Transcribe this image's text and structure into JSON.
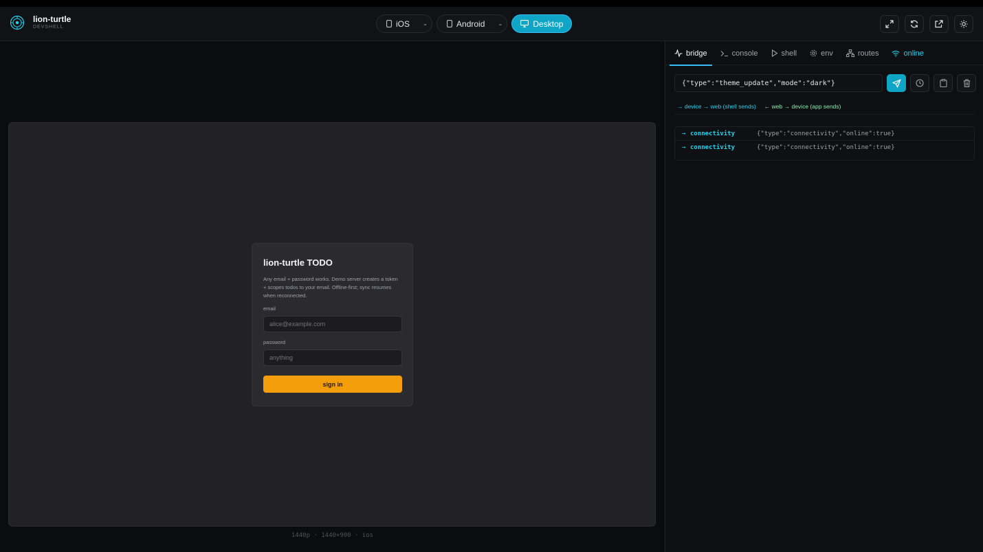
{
  "brand": {
    "title": "lion-turtle",
    "subtitle": "DEVSHELL"
  },
  "devices": [
    {
      "label": "iOS",
      "icon": "phone-icon"
    },
    {
      "label": "Android",
      "icon": "phone-icon"
    },
    {
      "label": "Desktop",
      "icon": "monitor-icon",
      "active": true
    }
  ],
  "header_actions": [
    "expand-icon",
    "refresh-icon",
    "external-link-icon",
    "sun-icon"
  ],
  "preview": {
    "caption": "1440p · 1440×900 · ios",
    "card": {
      "title": "lion-turtle TODO",
      "description": "Any email + password works. Demo server creates a token + scopes todos to your email. Offline-first; sync resumes when reconnected.",
      "email_label": "email",
      "email_placeholder": "alice@example.com",
      "password_label": "password",
      "password_placeholder": "anything",
      "submit_label": "sign in"
    }
  },
  "panel": {
    "tabs": [
      {
        "label": "bridge",
        "icon": "activity-icon"
      },
      {
        "label": "console",
        "icon": "terminal-icon"
      },
      {
        "label": "shell",
        "icon": "play-icon"
      },
      {
        "label": "env",
        "icon": "gear-icon"
      },
      {
        "label": "routes",
        "icon": "network-icon"
      },
      {
        "label": "online",
        "icon": "wifi-icon"
      }
    ],
    "message_value": "{\"type\":\"theme_update\",\"mode\":\"dark\"}",
    "legend": {
      "outgoing": "→ device → web (shell sends)",
      "incoming": "← web → device (app sends)"
    },
    "log": [
      {
        "dir": "→",
        "type": "connectivity",
        "payload": "{\"type\":\"connectivity\",\"online\":true}"
      },
      {
        "dir": "→",
        "type": "connectivity",
        "payload": "{\"type\":\"connectivity\",\"online\":true}"
      }
    ]
  },
  "colors": {
    "accent": "#0ea5c7",
    "primary_button": "#f59e0b",
    "online": "#22d3ee"
  }
}
